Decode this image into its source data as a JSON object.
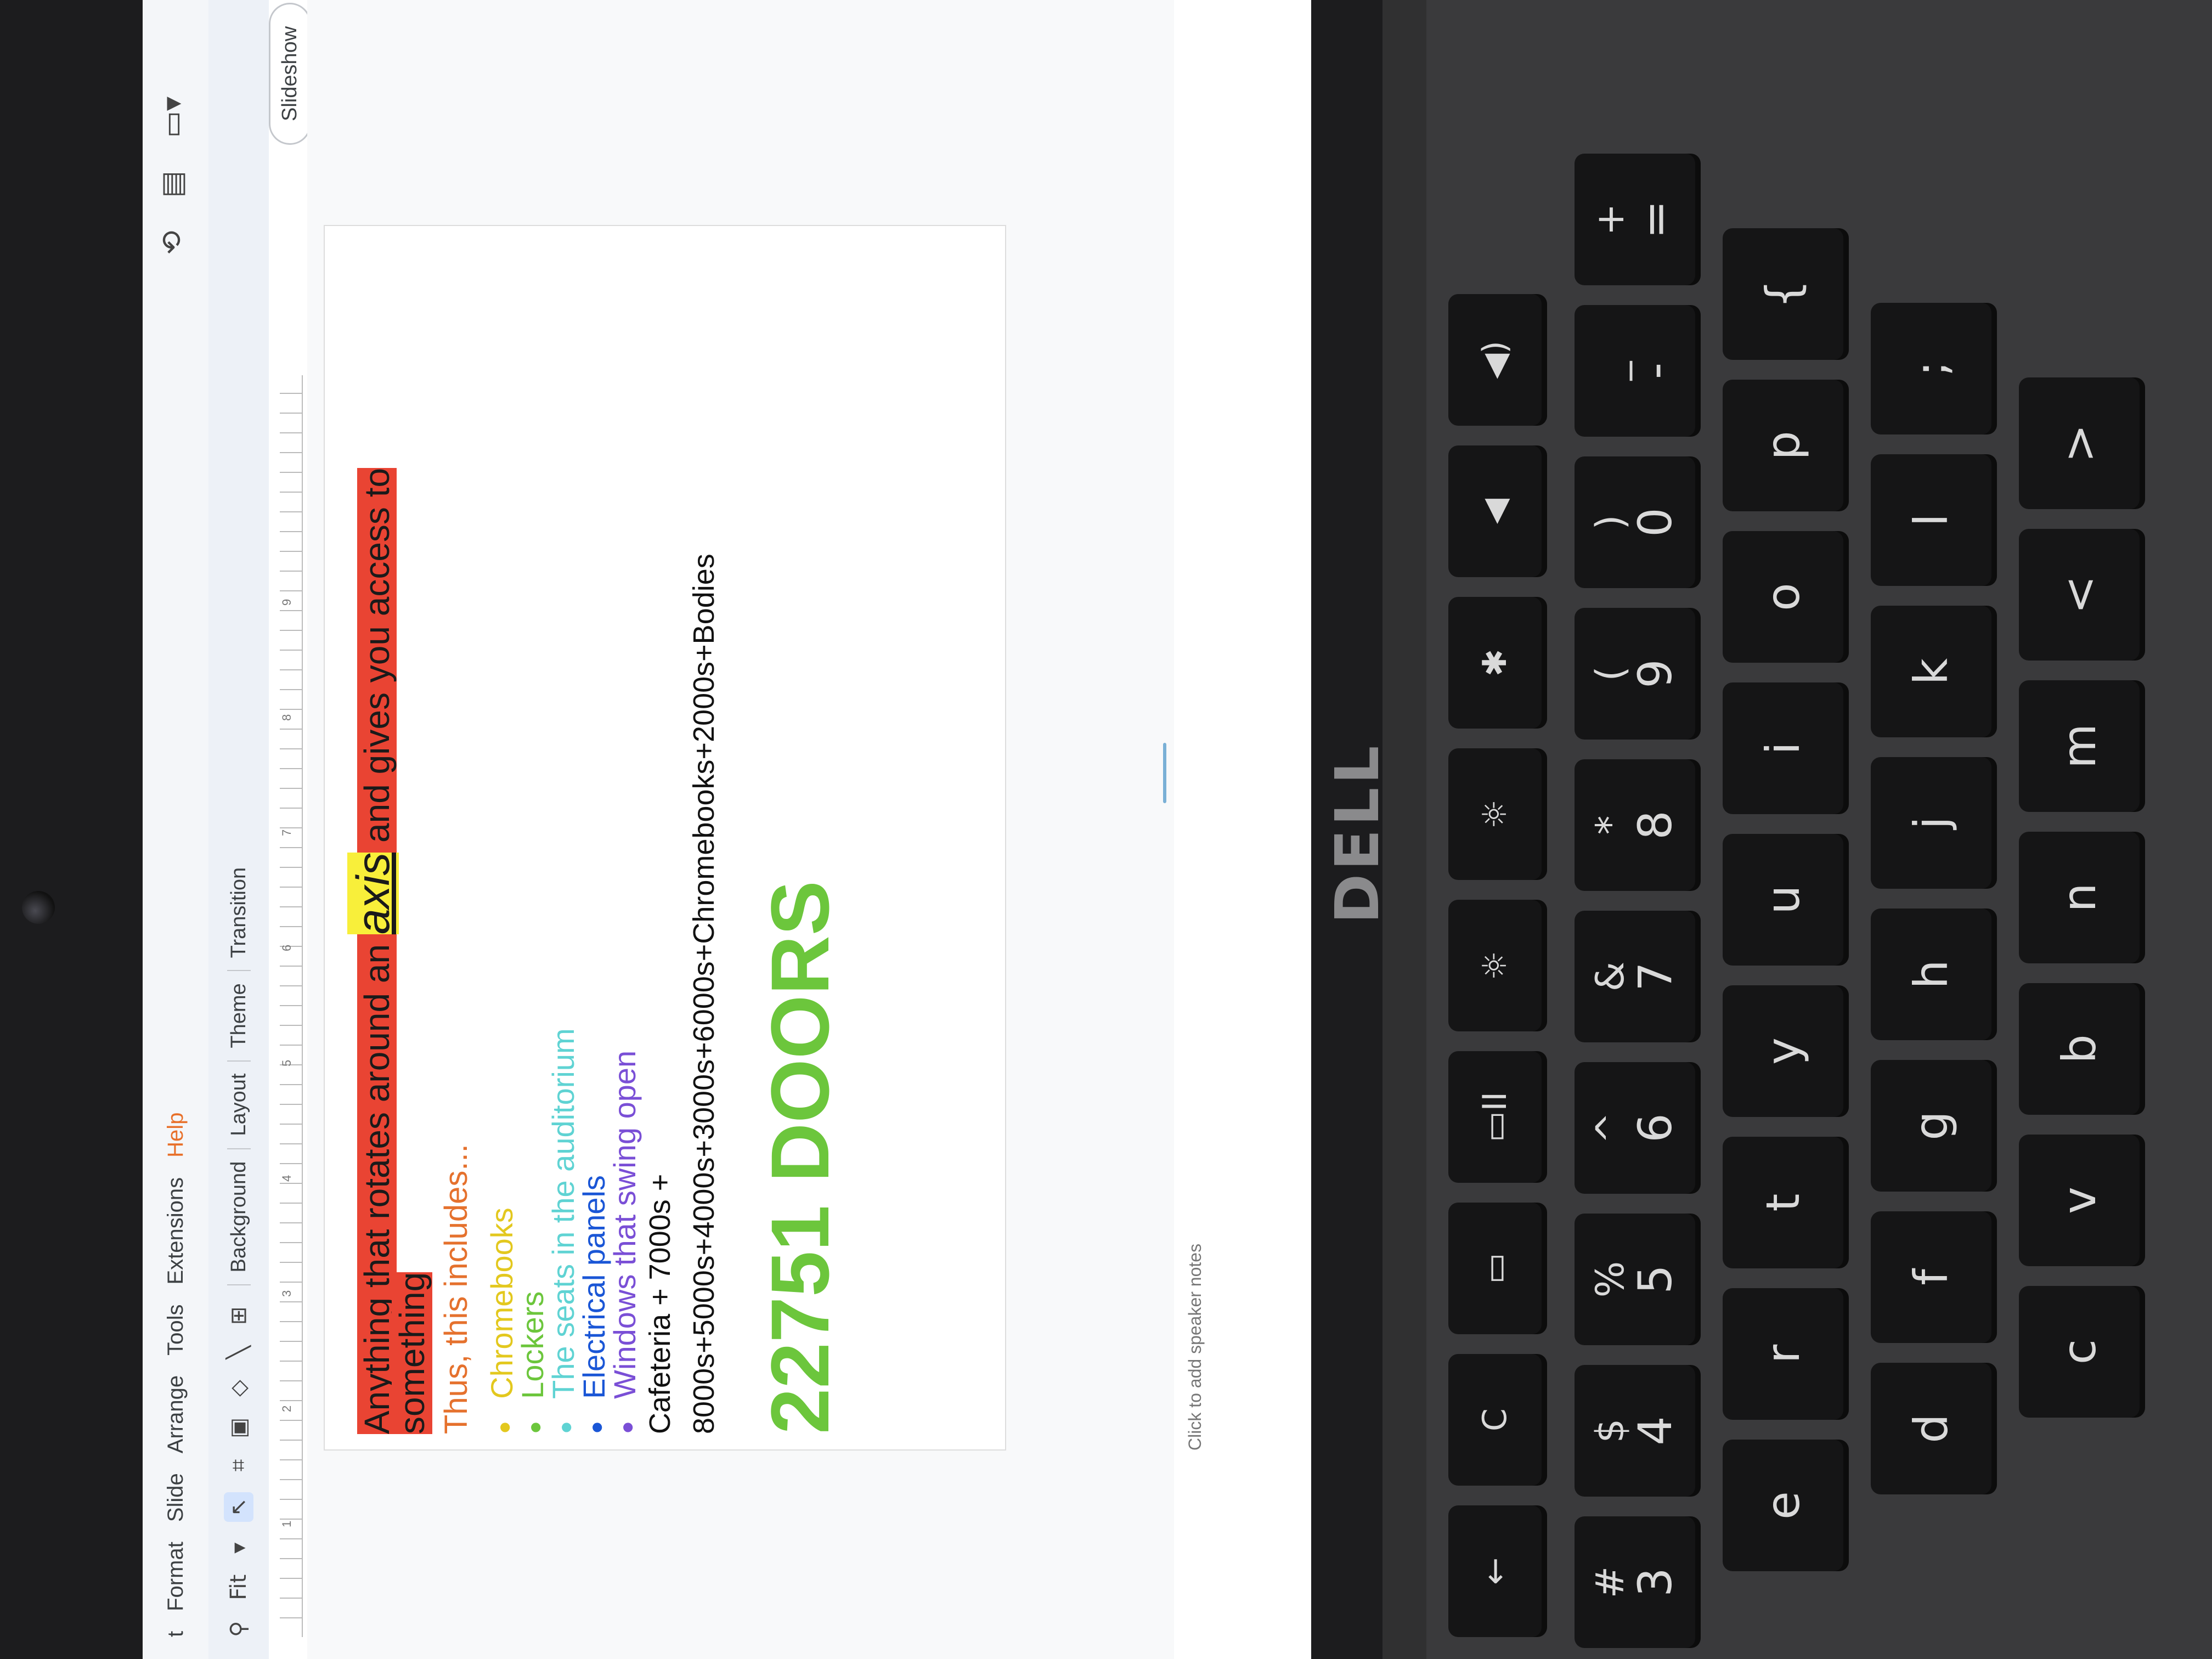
{
  "menu": {
    "items": [
      "t",
      "Format",
      "Slide",
      "Arrange",
      "Tools",
      "Extensions",
      "Help"
    ]
  },
  "title_icons": [
    "history-icon",
    "comment-icon",
    "camera-icon"
  ],
  "slideshow_label": "Slideshow",
  "toolbar": {
    "zoom_label": "Fit",
    "tabs": [
      "Background",
      "Layout",
      "Theme",
      "Transition"
    ]
  },
  "ruler": {
    "numbers": [
      "1",
      "2",
      "3",
      "4",
      "5",
      "6",
      "7",
      "8",
      "9"
    ]
  },
  "slide": {
    "line1_pre": "Anything that rotates around an ",
    "line1_axis": "axis",
    "line1_post": " and gives you access to",
    "line2": "something",
    "thus": "Thus, this includes...",
    "bullets": [
      {
        "text": "Chromebooks",
        "color": "#e3c81e"
      },
      {
        "text": "Lockers",
        "color": "#6cc63c"
      },
      {
        "text": "The seats in the auditorium",
        "color": "#5fd3d3"
      },
      {
        "text": "Electrical panels",
        "color": "#1a56d6"
      },
      {
        "text": "Windows that swing open",
        "color": "#7a4fd6"
      }
    ],
    "cafeteria": "Cafeteria + 7000s +",
    "sum": "8000s+5000s+4000s+3000s+6000s+Chromebooks+2000s+Bodies",
    "doors": "22751 DOORS"
  },
  "speaker_notes": "Click to add speaker notes",
  "logo": "DELL",
  "keyboard": {
    "row_func": [
      "←",
      "C",
      "▭",
      "▭II",
      "☼",
      "☼",
      "✱",
      "◀",
      "◀)"
    ],
    "row_num": [
      [
        "#",
        "3"
      ],
      [
        "$",
        "4"
      ],
      [
        "%",
        "5"
      ],
      [
        "^",
        "6"
      ],
      [
        "&",
        "7"
      ],
      [
        "*",
        "8"
      ],
      [
        "(",
        "9"
      ],
      [
        ")",
        "0"
      ],
      [
        "_",
        "-"
      ],
      [
        "+",
        "="
      ]
    ],
    "row_qwerty": [
      "e",
      "r",
      "t",
      "y",
      "u",
      "i",
      "o",
      "p",
      "{"
    ],
    "row_home": [
      "d",
      "f",
      "g",
      "h",
      "j",
      "k",
      "l",
      ";"
    ],
    "row_bottom": [
      "c",
      "v",
      "b",
      "n",
      "m",
      "<",
      ">"
    ]
  }
}
